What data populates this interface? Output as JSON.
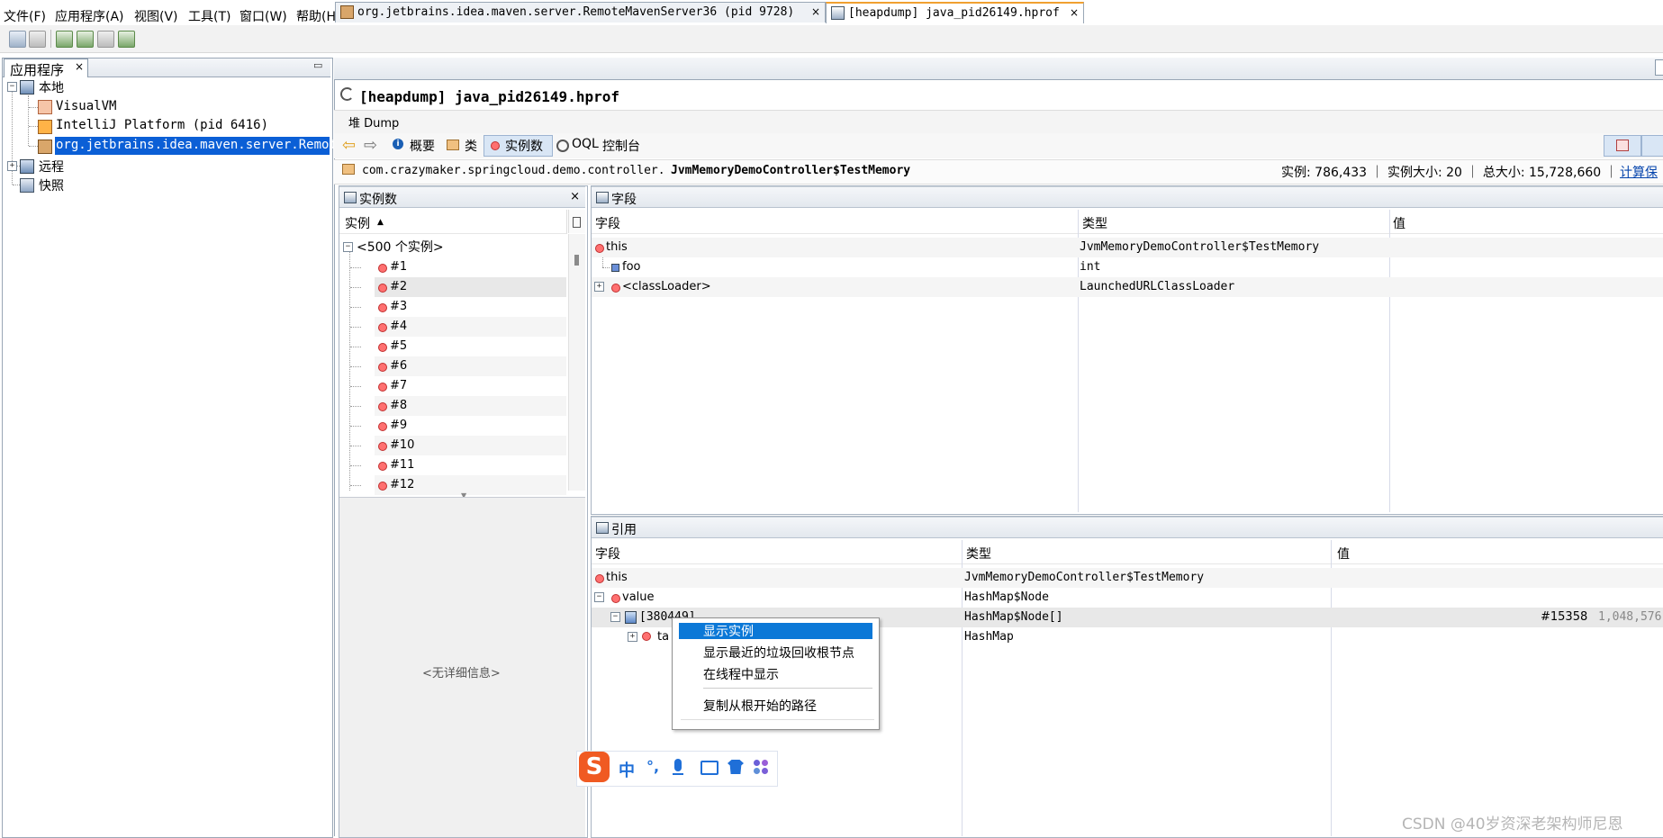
{
  "menu": [
    "文件(F)",
    "应用程序(A)",
    "视图(V)",
    "工具(T)",
    "窗口(W)",
    "帮助(H)"
  ],
  "left_panel": {
    "tab_label": "应用程序",
    "tab_close": "×",
    "minimize": "▭",
    "tree": {
      "local": "本地",
      "visualvm": "VisualVM",
      "intellij": "IntelliJ Platform (pid 6416)",
      "maven": "org.jetbrains.idea.maven.server.RemoteM",
      "remote": "远程",
      "snapshot": "快照"
    }
  },
  "doc_tabs": [
    {
      "label": "org.jetbrains.idea.maven.server.RemoteMavenServer36 (pid 9728)",
      "close": "×"
    },
    {
      "label": "[heapdump] java_pid26149.hprof",
      "close": "×"
    }
  ],
  "heapdump": {
    "title": "[heapdump] java_pid26149.hprof",
    "subtitle": "堆 Dump",
    "nav": {
      "summary": "概要",
      "classes": "类",
      "instances": "实例数",
      "oql": "OQL",
      "console": "控制台"
    },
    "class_path_prefix": "com.crazymaker.springcloud.demo.controller.",
    "class_name": "JvmMemoryDemoController$TestMemory",
    "stats": "实例: 786,433 ｜ 实例大小: 20 ｜ 总大小: 15,728,660 ｜",
    "stats_link": "计算保"
  },
  "instances_panel": {
    "title": "实例数",
    "close": "×",
    "column": "实例",
    "group": "<500 个实例>",
    "items": [
      "#1",
      "#2",
      "#3",
      "#4",
      "#5",
      "#6",
      "#7",
      "#8",
      "#9",
      "#10",
      "#11",
      "#12"
    ],
    "no_details": "<无详细信息>"
  },
  "fields_panel": {
    "title": "字段",
    "columns": [
      "字段",
      "类型",
      "值"
    ],
    "rows": [
      {
        "field": "this",
        "type": "JvmMemoryDemoController$TestMemory",
        "value": ""
      },
      {
        "field": "foo",
        "type": "int",
        "value": ""
      },
      {
        "field": "<classLoader>",
        "type": "LaunchedURLClassLoader",
        "value": ""
      }
    ]
  },
  "refs_panel": {
    "title": "引用",
    "columns": [
      "字段",
      "类型",
      "值"
    ],
    "rows": [
      {
        "field": "this",
        "type": "JvmMemoryDemoController$TestMemory",
        "value": ""
      },
      {
        "field": "value",
        "type": "HashMap$Node",
        "value": ""
      },
      {
        "field": "[380449]",
        "type": "HashMap$Node[]",
        "value": "#15358",
        "value2": "1,048,576"
      },
      {
        "field": "ta",
        "type": "HashMap",
        "value": ""
      }
    ]
  },
  "context_menu": [
    "显示实例",
    "显示最近的垃圾回收根节点",
    "在线程中显示",
    "复制从根开始的路径"
  ],
  "ime_bar": {
    "chinese": "中",
    "punct": "°,"
  },
  "watermark": "CSDN @40岁资深老架构师尼恩"
}
